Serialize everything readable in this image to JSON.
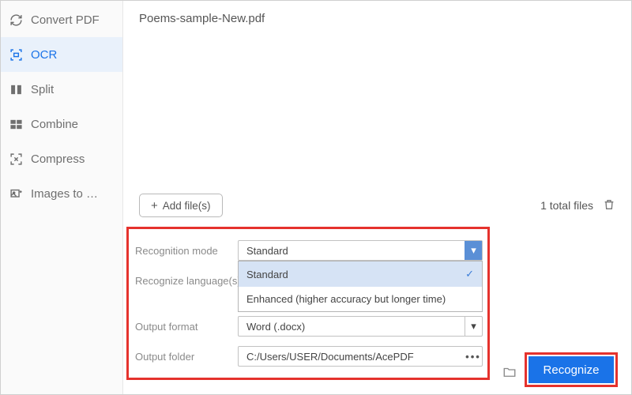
{
  "sidebar": {
    "items": [
      {
        "label": "Convert PDF",
        "icon": "convert-icon"
      },
      {
        "label": "OCR",
        "icon": "ocr-icon"
      },
      {
        "label": "Split",
        "icon": "split-icon"
      },
      {
        "label": "Combine",
        "icon": "combine-icon"
      },
      {
        "label": "Compress",
        "icon": "compress-icon"
      },
      {
        "label": "Images to …",
        "icon": "images-to-icon"
      }
    ]
  },
  "file_area": {
    "filename": "Poems-sample-New.pdf"
  },
  "add_bar": {
    "add_label": "Add file(s)",
    "total_label": "1 total files"
  },
  "settings": {
    "recognition_mode": {
      "label": "Recognition mode",
      "selected": "Standard",
      "options": [
        "Standard",
        "Enhanced (higher accuracy but longer time)"
      ]
    },
    "recognize_language": {
      "label": "Recognize language(s)"
    },
    "output_format": {
      "label": "Output format",
      "value": "Word (.docx)"
    },
    "output_folder": {
      "label": "Output folder",
      "value": "C:/Users/USER/Documents/AcePDF"
    }
  },
  "actions": {
    "recognize": "Recognize"
  }
}
